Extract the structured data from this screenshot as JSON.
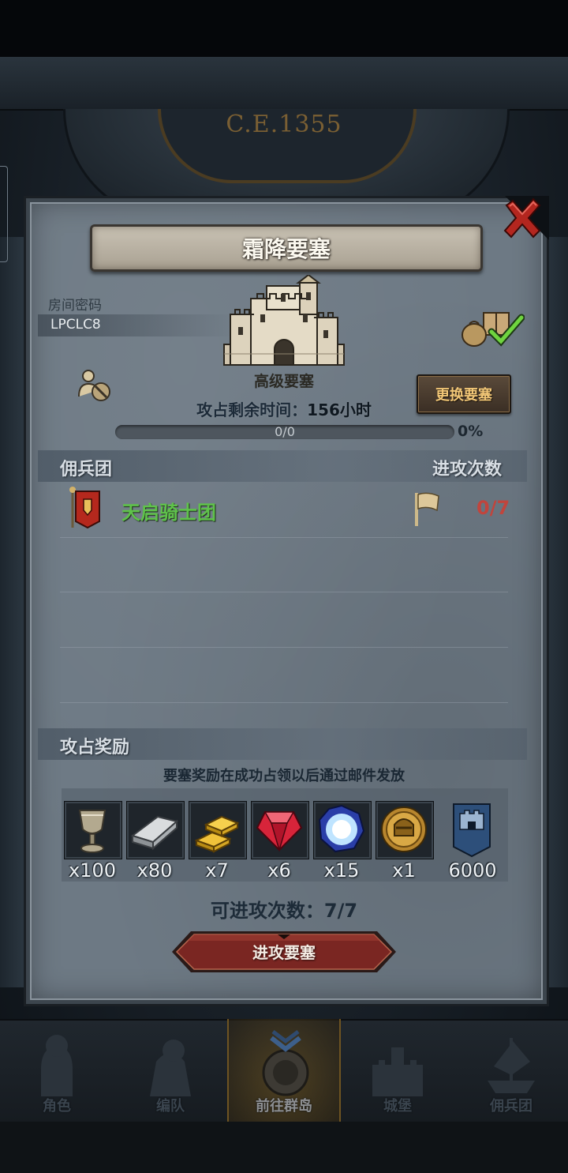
{
  "background": {
    "era_label": "C.E.1355"
  },
  "dialog": {
    "title": "霜降要塞",
    "room": {
      "label": "房间密码",
      "code": "LPCLC8"
    },
    "fortress": {
      "grade": "高级要塞",
      "time_label": "攻占剩余时间：",
      "time_value": "156小时",
      "progress_text": "0/0",
      "progress_percent_text": "0%",
      "progress_fraction": 0
    },
    "change_button": "更换要塞",
    "mercenary_section": {
      "title": "佣兵团",
      "attack_header": "进攻次数",
      "rows": [
        {
          "name": "天启骑士团",
          "attacks": "0/7"
        }
      ]
    },
    "rewards_section": {
      "title": "攻占奖励",
      "note": "要塞奖励在成功占领以后通过邮件发放",
      "items": [
        {
          "icon": "goblet-icon",
          "qty": "x100"
        },
        {
          "icon": "iron-ingot-icon",
          "qty": "x80"
        },
        {
          "icon": "gold-bars-icon",
          "qty": "x7"
        },
        {
          "icon": "ruby-icon",
          "qty": "x6"
        },
        {
          "icon": "crystal-orb-icon",
          "qty": "x15"
        },
        {
          "icon": "knight-medal-icon",
          "qty": "x1"
        },
        {
          "icon": "fortress-banner-icon",
          "qty": "6000"
        }
      ]
    },
    "attack_remaining": "可进攻次数：7/7",
    "attack_button": "进攻要塞"
  },
  "colors": {
    "guild_name": "#5fc24b",
    "attack_count": "#c0453d",
    "change_button_text": "#f2c777",
    "attack_button": "#7a2622"
  },
  "bottom_nav": {
    "items": [
      {
        "label": "角色",
        "icon": "knight-helmet-icon",
        "active": false
      },
      {
        "label": "编队",
        "icon": "armored-knight-icon",
        "active": false
      },
      {
        "label": "前往群岛",
        "icon": "compass-icon",
        "active": true
      },
      {
        "label": "城堡",
        "icon": "castle-icon",
        "active": false
      },
      {
        "label": "佣兵团",
        "icon": "ship-icon",
        "active": false
      }
    ]
  }
}
